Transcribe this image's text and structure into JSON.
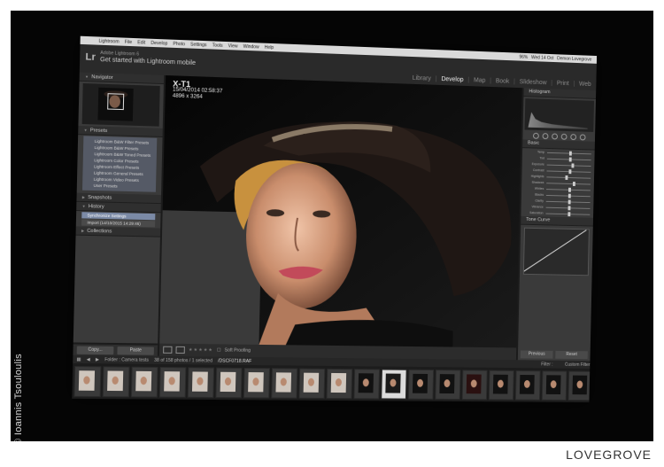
{
  "credit": "© Ioannis Tsouloulis",
  "brand": "LOVEGROVE",
  "menubar": {
    "items": [
      "Lightroom",
      "File",
      "Edit",
      "Develop",
      "Photo",
      "Settings",
      "Tools",
      "View",
      "Window",
      "Help"
    ],
    "status": [
      "96%",
      "Wed 14 Oct",
      "Demon Lovegrove"
    ]
  },
  "lr": {
    "logo": "Lr",
    "ident_small": "Adobe Lightroom 6",
    "ident_big": "Get started with Lightroom mobile",
    "modules": [
      "Library",
      "Develop",
      "Map",
      "Book",
      "Slideshow",
      "Print",
      "Web"
    ],
    "active_module": "Develop"
  },
  "left": {
    "navigator": "Navigator",
    "presets": "Presets",
    "preset_items": [
      "Lightroom B&W Filter Presets",
      "Lightroom B&W Presets",
      "Lightroom B&W Toned Presets",
      "Lightroom Color Presets",
      "Lightroom Effect Presets",
      "Lightroom General Presets",
      "Lightroom Video Presets",
      "User Presets"
    ],
    "snapshots": "Snapshots",
    "history": "History",
    "history_items": [
      "Synchronize Settings",
      "Import (14/10/2015 14:29:46)"
    ],
    "collections": "Collections",
    "copy": "Copy...",
    "paste": "Paste"
  },
  "image_info": {
    "camera": "X-T1",
    "date": "15/04/2014 02:58:37",
    "size": "4896 x 3264"
  },
  "toolbar": {
    "stars": "★★★★★",
    "soft_proofing": "Soft Proofing"
  },
  "right": {
    "histogram": "Histogram",
    "basic": "Basic",
    "tone_curve": "Tone Curve",
    "sliders": [
      "Temp",
      "Tint",
      "Exposure",
      "Contrast",
      "Highlights",
      "Shadows",
      "Whites",
      "Blacks",
      "Clarity",
      "Vibrance",
      "Saturation"
    ],
    "slider_levels": [
      0.5,
      0.5,
      0.55,
      0.5,
      0.42,
      0.6,
      0.5,
      0.5,
      0.5,
      0.5,
      0.5
    ],
    "previous": "Previous",
    "reset": "Reset"
  },
  "filmstrip": {
    "folder": "Folder : Camera tests",
    "count": "38 of 158 photos / 1 selected",
    "file": "/DSCF0718.RAF",
    "filter": "Filter :",
    "custom_filter": "Custom Filter"
  }
}
